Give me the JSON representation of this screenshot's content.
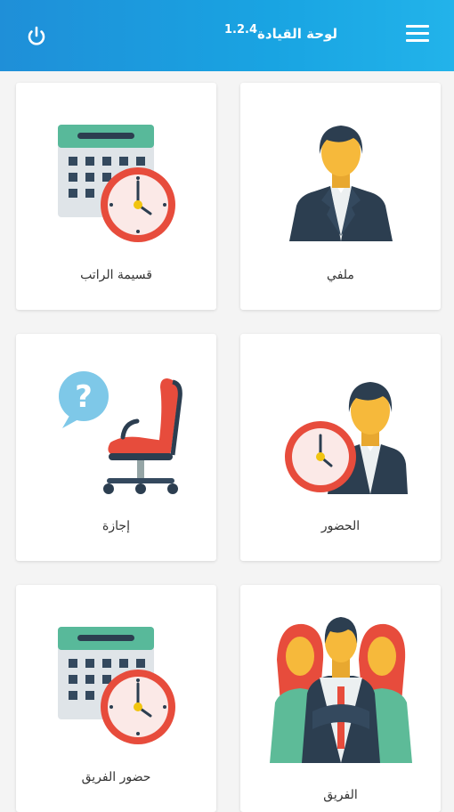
{
  "header": {
    "title": "لوحة القيادة",
    "version": "1.2.4",
    "menu_icon": "hamburger-menu-icon",
    "power_icon": "power-icon",
    "background": "#1f8fd8"
  },
  "tiles": [
    {
      "id": "profile",
      "label": "ملفي",
      "icon": "businessman-icon"
    },
    {
      "id": "payslip",
      "label": "قسيمة الراتب",
      "icon": "calendar-clock-icon"
    },
    {
      "id": "attendance",
      "label": "الحضور",
      "icon": "man-clock-icon"
    },
    {
      "id": "leave",
      "label": "إجازة",
      "icon": "empty-chair-question-icon"
    },
    {
      "id": "team",
      "label": "الفريق",
      "icon": "team-icon"
    },
    {
      "id": "team_attendance",
      "label": "حضور الفريق",
      "icon": "calendar-clock-icon"
    }
  ]
}
